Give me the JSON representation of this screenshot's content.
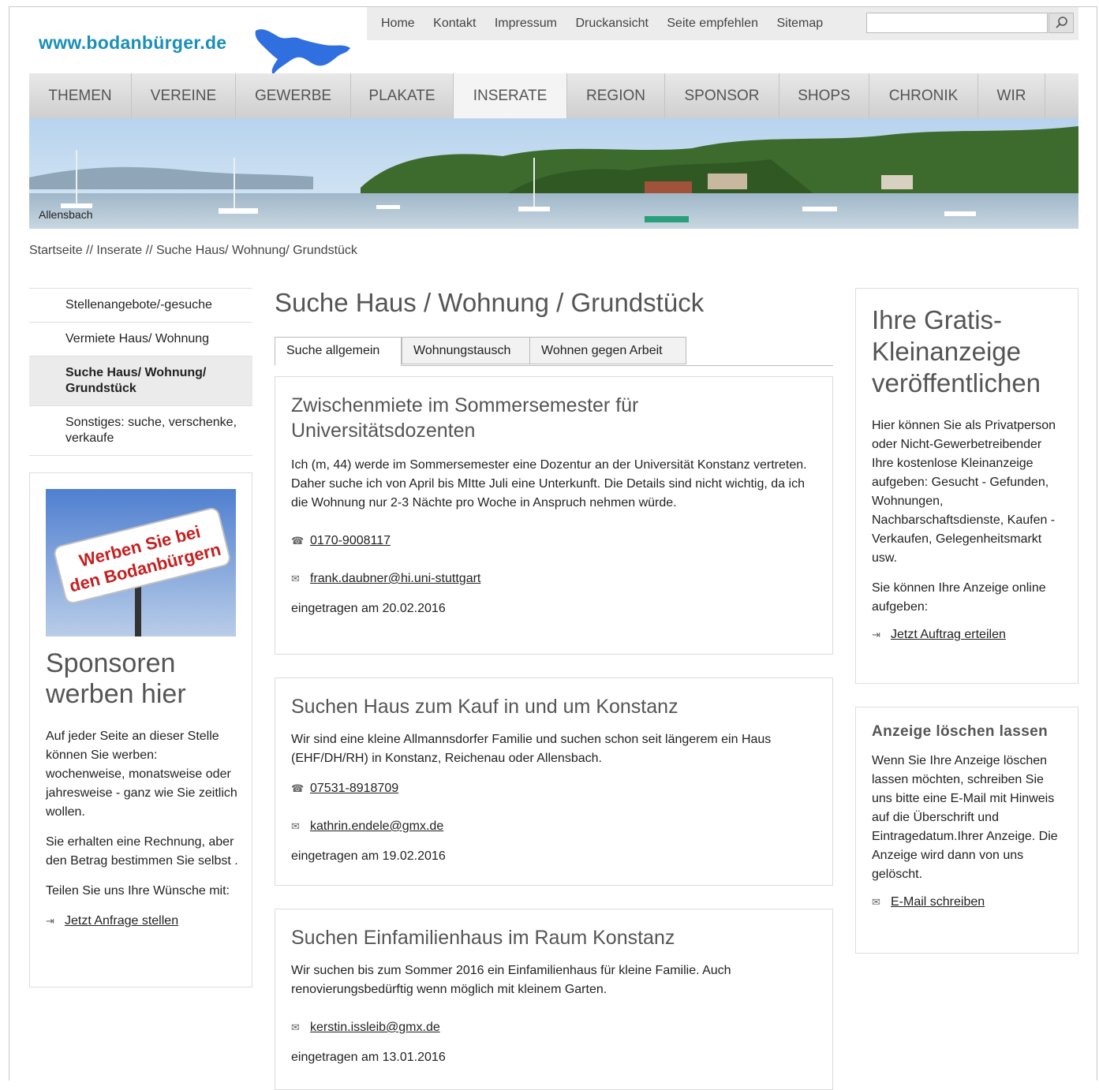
{
  "header": {
    "logo_text": "www.bodanbürger.de",
    "top_links": [
      "Home",
      "Kontakt",
      "Impressum",
      "Druckansicht",
      "Seite empfehlen",
      "Sitemap"
    ],
    "search_placeholder": ""
  },
  "nav": {
    "items": [
      "THEMEN",
      "VEREINE",
      "GEWERBE",
      "PLAKATE",
      "INSERATE",
      "REGION",
      "SPONSOR",
      "SHOPS",
      "CHRONIK",
      "WIR"
    ],
    "active": "INSERATE"
  },
  "banner": {
    "label": "Allensbach"
  },
  "breadcrumb": "Startseite // Inserate // Suche Haus/ Wohnung/ Grundstück",
  "sidebar": {
    "items": [
      "Stellenangebote/-gesuche",
      "Vermiete Haus/ Wohnung",
      "Suche Haus/ Wohnung/ Grundstück",
      "Sonstiges: suche, verschenke, verkaufe"
    ],
    "sponsor": {
      "image_line1": "Werben Sie bei",
      "image_line2": "den Bodanbürgern",
      "title": "Sponsoren werben hier",
      "p1": "Auf jeder Seite an dieser Stelle können Sie werben: wochenweise, monatsweise oder jahresweise - ganz wie Sie zeitlich wollen.",
      "p2": "Sie erhalten eine Rechnung, aber den Betrag bestimmen Sie selbst .",
      "p3": "Teilen Sie uns Ihre Wünsche mit:",
      "link": "Jetzt Anfrage stellen"
    }
  },
  "main": {
    "title": "Suche Haus / Wohnung / Grundstück",
    "tabs": [
      "Suche allgemein",
      "Wohnungstausch",
      "Wohnen gegen Arbeit"
    ],
    "listings": [
      {
        "title": "Zwischenmiete im Sommersemester für Universitätsdozenten",
        "text": "Ich (m, 44) werde im Sommersemester eine Dozentur an der Universität Konstanz vertreten. Daher suche ich von April bis MItte Juli eine Unterkunft. Die Details sind nicht wichtig, da ich die Wohnung nur 2-3 Nächte pro Woche in Anspruch nehmen würde.",
        "phone": "0170-9008117",
        "email": "frank.daubner@hi.uni-stuttgart",
        "date": "eingetragen am 20.02.2016"
      },
      {
        "title": "Suchen Haus zum Kauf in und um Konstanz",
        "text": "Wir sind eine kleine Allmannsdorfer Familie und suchen schon seit längerem ein Haus (EHF/DH/RH) in Konstanz, Reichenau oder Allensbach.",
        "phone": "07531-8918709",
        "email": "kathrin.endele@gmx.de",
        "date": "eingetragen am 19.02.2016"
      },
      {
        "title": "Suchen Einfamilienhaus im Raum Konstanz",
        "text": "Wir suchen bis zum Sommer 2016 ein Einfamilienhaus für kleine Familie. Auch renovierungsbedürftig wenn möglich mit kleinem Garten.",
        "email": "kerstin.issleib@gmx.de",
        "date": "eingetragen am 13.01.2016"
      }
    ]
  },
  "right": {
    "box1": {
      "title": "Ihre Gratis-Kleinanzeige veröffentlichen",
      "p1": "Hier können Sie als Privatperson oder Nicht-Gewerbetreibender Ihre kostenlose Kleinanzeige aufgeben: Gesucht - Gefunden, Wohnungen, Nachbarschaftsdienste, Kaufen - Verkaufen, Gelegenheitsmarkt usw.",
      "p2": "Sie können Ihre Anzeige online aufgeben:",
      "link": "Jetzt Auftrag erteilen"
    },
    "box2": {
      "title": "Anzeige löschen lassen",
      "p1": "Wenn Sie Ihre Anzeige löschen lassen möchten, schreiben Sie uns bitte eine E-Mail mit Hinweis auf die Überschrift und Eintragedatum.Ihrer Anzeige. Die Anzeige wird dann von uns gelöscht.",
      "link": "E-Mail schreiben"
    }
  },
  "colors": {
    "logo": "#1a8fb8",
    "nav_bg": "#d6d6d6",
    "lake": "#2f6fe0"
  }
}
